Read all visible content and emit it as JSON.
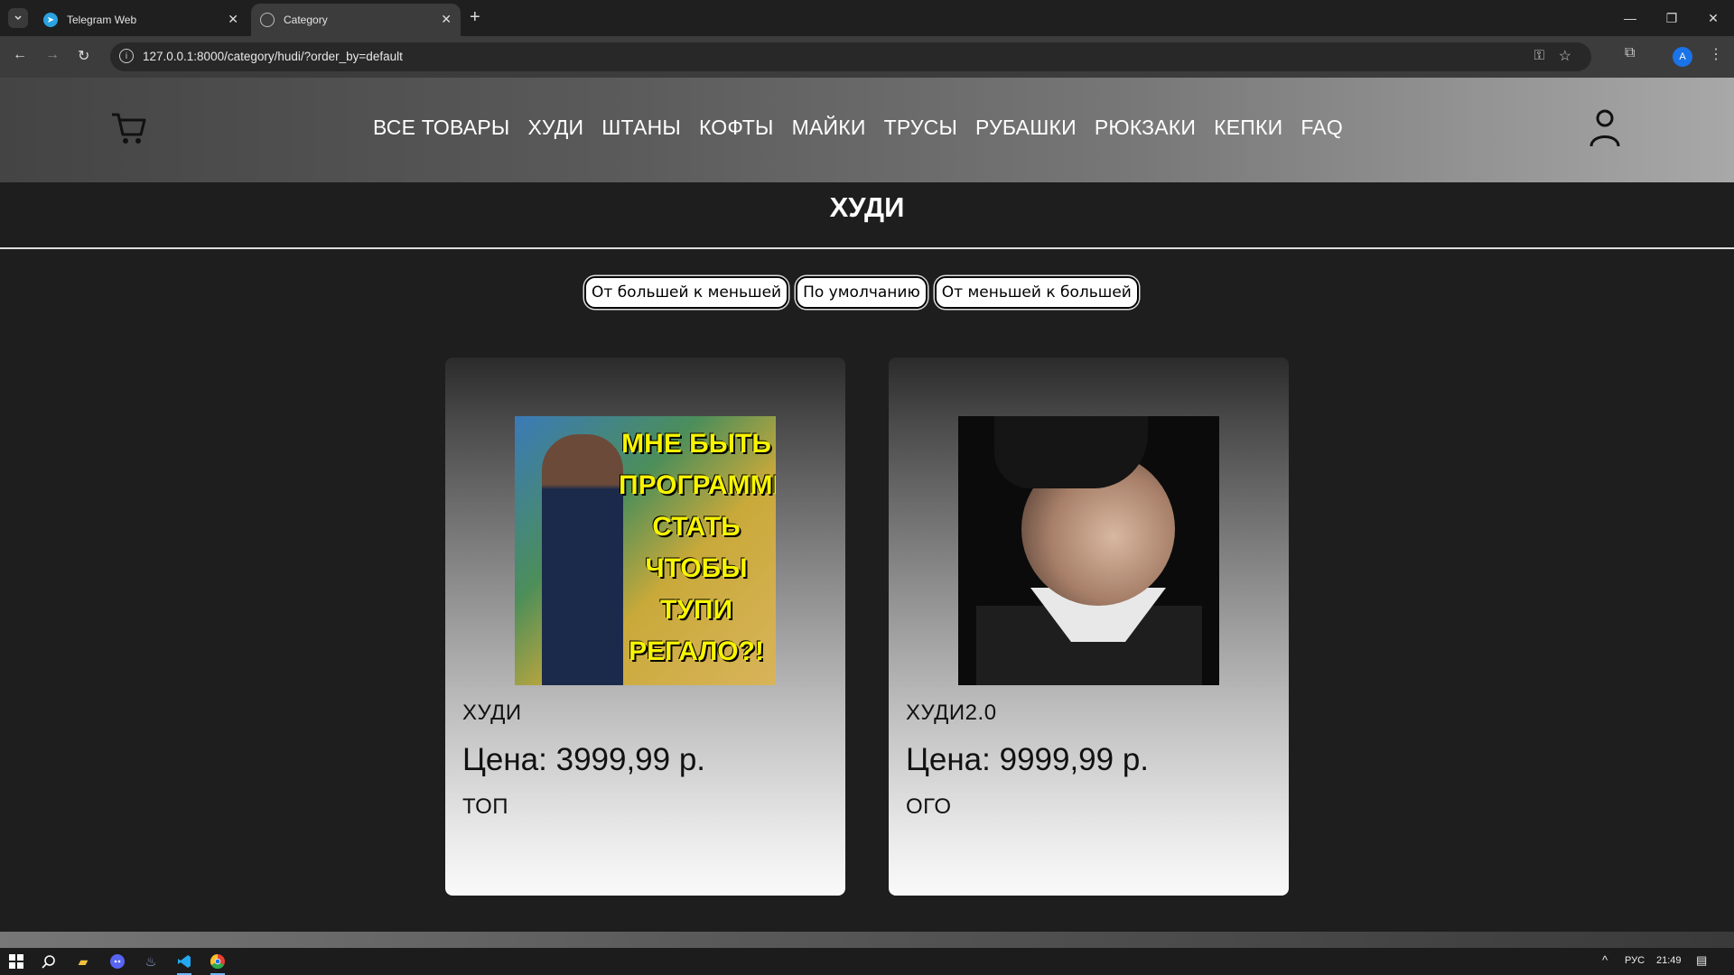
{
  "browser": {
    "tabs": [
      {
        "title": "Telegram Web",
        "active": false
      },
      {
        "title": "Category",
        "active": true
      }
    ],
    "url": "127.0.0.1:8000/category/hudi/?order_by=default",
    "profile_initial": "A"
  },
  "header": {
    "nav": [
      "ВСЕ ТОВАРЫ",
      "ХУДИ",
      "ШТАНЫ",
      "КОФТЫ",
      "МАЙКИ",
      "ТРУСЫ",
      "РУБАШКИ",
      "РЮКЗАКИ",
      "КЕПКИ",
      "FAQ"
    ]
  },
  "page": {
    "title": "ХУДИ",
    "sort_buttons": [
      "От большей к меньшей",
      "По умолчанию",
      "От меньшей к большей"
    ]
  },
  "products": [
    {
      "name": "ХУДИ",
      "price": "Цена: 3999,99 р.",
      "description": "ТОП",
      "image_text": "МНЕ БЫТЬ ПРОГРАММИСТОМ СТАТЬ ЧТОБЫ ТУПИ РЕГАЛО?!"
    },
    {
      "name": "ХУДИ2.0",
      "price": "Цена: 9999,99 р.",
      "description": "ОГО"
    }
  ],
  "taskbar": {
    "lang": "РУС",
    "time": "21:49"
  },
  "colors": {
    "page_bg": "#1e1e1e",
    "accent_blue": "#1a73e8"
  }
}
